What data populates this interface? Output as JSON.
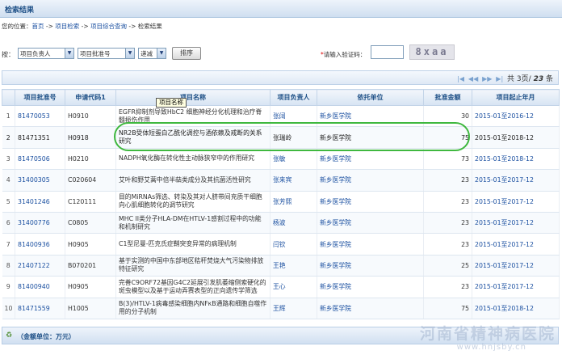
{
  "title": "检索结果",
  "breadcrumb": {
    "prefix": "您的位置：",
    "items": [
      "首页",
      "项目检索",
      "项目综合查询",
      "检索结果"
    ],
    "separator": " -> "
  },
  "sort": {
    "label": "按：",
    "field1": "项目负责人",
    "field2": "项目批准号",
    "order": "递减",
    "button": "排序"
  },
  "captcha": {
    "label": "请输入验证码：",
    "star": "*",
    "value": "",
    "image_text": "8xaa"
  },
  "pager": {
    "icons": [
      "|◀",
      "◀◀",
      "▶▶",
      "▶|"
    ],
    "text_prefix": "共",
    "current": "3",
    "slash": "页/",
    "total": "23",
    "suffix": "条"
  },
  "columns": [
    "",
    "项目批准号",
    "申请代码1",
    "项目名称",
    "项目负责人",
    "依托单位",
    "批准金额",
    "项目起止年月"
  ],
  "rows": [
    {
      "no": "1",
      "code": "81470053",
      "apply": "H0910",
      "name": "EGFR抑制剂导致HbC2 细胞神经分化机理和治疗脊髓损伤作用",
      "person": "张阔",
      "unit": "新乡医学院",
      "amount": "30",
      "period": "2015-01至2016-12"
    },
    {
      "no": "2",
      "code": "81471351",
      "apply": "H0918",
      "name": "NR2B受体短蛋白乙酰化调控与酒依赖及戒断的关系研究",
      "person": "张瑞岭",
      "unit": "新乡医学院",
      "amount": "75",
      "period": "2015-01至2018-12"
    },
    {
      "no": "3",
      "code": "81470506",
      "apply": "H0210",
      "name": "NADPH氧化酶在转化性主动脉狭窄中的作用研究",
      "person": "张敏",
      "unit": "新乡医学院",
      "amount": "73",
      "period": "2015-01至2018-12"
    },
    {
      "no": "4",
      "code": "31400305",
      "apply": "C020604",
      "name": "艾叶和野艾蒿中倍半萜类成分及其抗菌活性研究",
      "person": "张来宾",
      "unit": "新乡医学院",
      "amount": "23",
      "period": "2015-01至2017-12"
    },
    {
      "no": "5",
      "code": "31401246",
      "apply": "C120111",
      "name": "目的MiRNAs筛选、转染及其对人脐带间充质干细胞向心肌细胞转化的调节研究",
      "person": "张芳熙",
      "unit": "新乡医学院",
      "amount": "23",
      "period": "2015-01至2017-12"
    },
    {
      "no": "6",
      "code": "31400776",
      "apply": "C0805",
      "name": "MHC II类分子HLA-DM在HTLV-1感割过程中的功能和机制研究",
      "person": "杨波",
      "unit": "新乡医学院",
      "amount": "23",
      "period": "2015-01至2017-12"
    },
    {
      "no": "7",
      "code": "81400936",
      "apply": "H0905",
      "name": "C1型尼曼-匹克氏症鞘突变异常的病理机制",
      "person": "闫钦",
      "unit": "新乡医学院",
      "amount": "23",
      "period": "2015-01至2017-12"
    },
    {
      "no": "8",
      "code": "21407122",
      "apply": "B070201",
      "name": "基于实测的中国中东部地区秸秆焚烧大气污染物排放特征研究",
      "person": "王艳",
      "unit": "新乡医学院",
      "amount": "25",
      "period": "2015-01至2017-12"
    },
    {
      "no": "9",
      "code": "81400940",
      "apply": "H0905",
      "name": "完善C9ORF72基因G4C2延展引发肌萎缩侧索硬化的斑虫模型以及基于运动弄赛表型的正向遗传学筛选",
      "person": "王心",
      "unit": "新乡医学院",
      "amount": "23",
      "period": "2015-01至2017-12"
    },
    {
      "no": "10",
      "code": "81471559",
      "apply": "H1005",
      "name": "B(3)/HTLV-1病毒感染细胞内NFκB通路和细胞自噬作用的分子机制",
      "person": "王辉",
      "unit": "新乡医学院",
      "amount": "75",
      "period": "2015-01至2018-12"
    }
  ],
  "tooltip": "项目名称",
  "footer": {
    "icon": "refresh-icon",
    "text": "（金额单位：万元）"
  },
  "watermark": {
    "main": "河南省精神病医院",
    "url": "www.hnjsby.cn"
  },
  "colors": {
    "header_blue": "#1d4f86",
    "link_blue": "#1a4fa0",
    "highlight_ring": "#3fb83f"
  }
}
